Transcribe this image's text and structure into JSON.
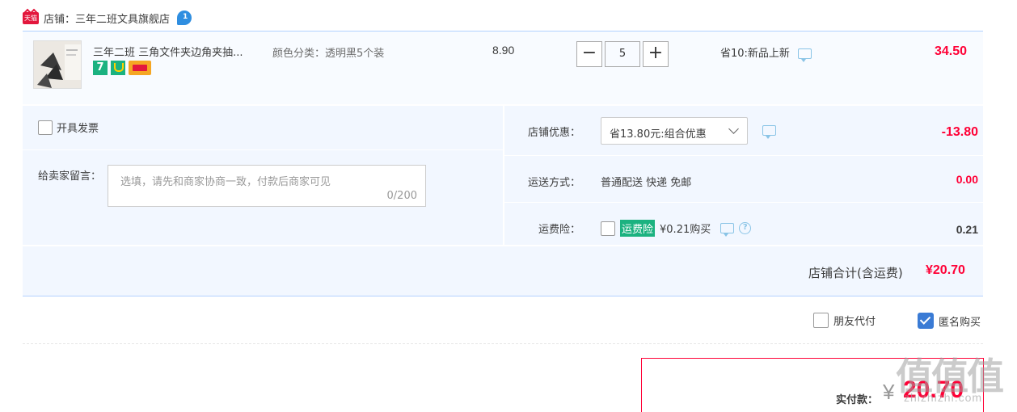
{
  "shop": {
    "badge_text": "天猫",
    "label": "店铺：三年二班文具旗舰店",
    "msg_count": "1"
  },
  "item": {
    "title": "三年二班 三角文件夹边角夹抽...",
    "sku": "颜色分类：透明黑5个装",
    "unit_price": "8.90",
    "quantity": "5",
    "decrement_label": "−",
    "increment_label": "+",
    "promo": "省10:新品上新",
    "total": "34.50",
    "badges": [
      "7"
    ]
  },
  "invoice": {
    "label": "开具发票"
  },
  "message": {
    "label": "给卖家留言：",
    "placeholder": "选填，请先和商家协商一致，付款后商家可见",
    "count": "0/200"
  },
  "discount": {
    "label": "店铺优惠：",
    "selected": "省13.80元:组合优惠",
    "value": "-13.80"
  },
  "shipping": {
    "label": "运送方式：",
    "method": "普通配送 快递 免邮",
    "value": "0.00"
  },
  "insurance": {
    "label": "运费险：",
    "tag": "运费险",
    "price": "¥0.21购买",
    "value": "0.21"
  },
  "shop_total": {
    "label": "店铺合计(含运费)",
    "value": "¥20.70"
  },
  "options": {
    "friend_pay": "朋友代付",
    "anonymous": "匿名购买"
  },
  "payment": {
    "label": "实付款：",
    "currency": "¥",
    "amount": "20.70"
  },
  "watermark": {
    "logo": "值值值",
    "url": "zhizhizhi.com"
  },
  "colors": {
    "accent_red": "#ff0036",
    "panel_bg": "#f2f7ff",
    "border_blue": "#b2d1ff",
    "badge_green": "#1bb280",
    "check_blue": "#3a7bd5"
  }
}
